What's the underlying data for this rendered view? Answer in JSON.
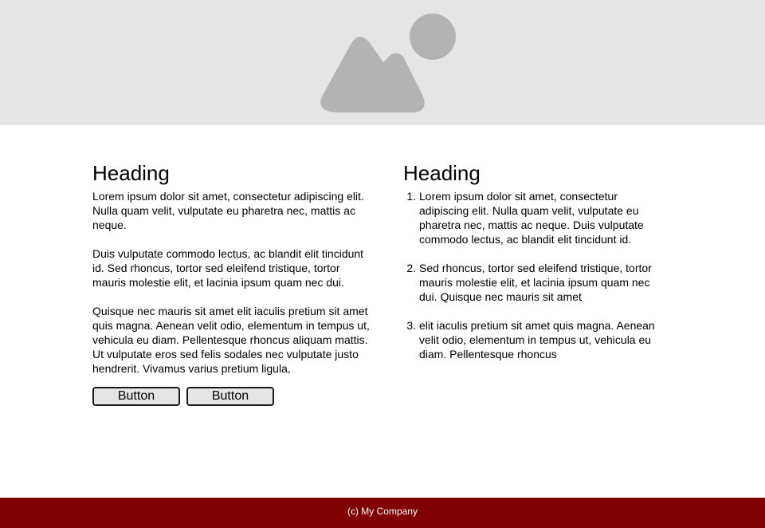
{
  "hero": {
    "image_icon": "landscape-image-icon",
    "background": "#e5e5e5",
    "icon_color": "#b3b3b3"
  },
  "left_column": {
    "heading": "Heading",
    "paragraphs": [
      "Lorem ipsum dolor sit amet, consectetur adipiscing elit. Nulla quam velit, vulputate eu pharetra nec, mattis ac neque.",
      "Duis vulputate commodo lectus, ac blandit elit tincidunt id. Sed rhoncus, tortor sed eleifend tristique, tortor mauris molestie elit, et lacinia ipsum quam nec dui.",
      "Quisque nec mauris sit amet elit iaculis pretium sit amet quis magna. Aenean velit odio, elementum in tempus ut, vehicula eu diam. Pellentesque rhoncus aliquam mattis. Ut vulputate eros sed felis sodales nec vulputate justo hendrerit. Vivamus varius pretium ligula,"
    ],
    "buttons": [
      "Button",
      "Button"
    ]
  },
  "right_column": {
    "heading": "Heading",
    "items": [
      "Lorem ipsum dolor sit amet, consectetur adipiscing elit. Nulla quam velit, vulputate eu pharetra nec, mattis ac neque. Duis vulputate commodo lectus, ac blandit elit tincidunt id.",
      "Sed rhoncus, tortor sed eleifend tristique, tortor mauris molestie elit, et lacinia ipsum quam nec dui. Quisque nec mauris sit amet",
      "elit iaculis pretium sit amet quis magna. Aenean velit odio, elementum in tempus ut, vehicula eu diam. Pellentesque rhoncus"
    ]
  },
  "footer": {
    "text": "(c) My Company",
    "background": "#800000"
  }
}
